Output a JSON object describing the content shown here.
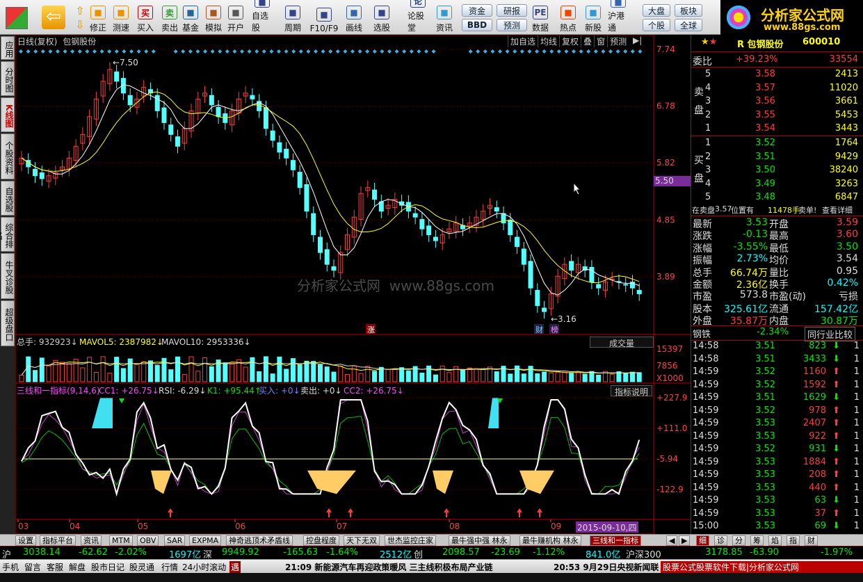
{
  "toolbar": {
    "buttons": [
      {
        "label": "修正",
        "icon": "refresh-icon"
      },
      {
        "label": "测速",
        "icon": "clock-icon"
      },
      {
        "label": "买入",
        "icon": "buy-icon",
        "glyph": "买"
      },
      {
        "label": "卖出",
        "icon": "sell-icon",
        "glyph": "卖"
      },
      {
        "label": "基金",
        "icon": "fund-icon"
      },
      {
        "label": "模拟",
        "icon": "hammer-icon"
      },
      {
        "label": "开户",
        "icon": "lock-icon"
      },
      {
        "label": "自选股",
        "icon": "star-icon"
      },
      {
        "label": "周期",
        "icon": "period-icon"
      },
      {
        "label": "F10/F9",
        "icon": "f10-icon"
      },
      {
        "label": "画线",
        "icon": "pen-icon"
      },
      {
        "label": "选股",
        "icon": "screen-icon"
      },
      {
        "label": "论股堂",
        "icon": "forum-icon",
        "glyph": "论"
      },
      {
        "label": "资讯",
        "icon": "news-icon"
      },
      {
        "label": "数据",
        "icon": "pe-icon",
        "glyph": "PE"
      },
      {
        "label": "热点",
        "icon": "hot-icon"
      },
      {
        "label": "新股",
        "icon": "ipo-icon"
      },
      {
        "label": "沪港通",
        "icon": "hk-icon"
      }
    ],
    "pills": {
      "fund": "资金",
      "research": "研报",
      "bbd": "BBD",
      "forecast": "预测",
      "dapan": "大盘",
      "bankuai": "板块",
      "gegu": "个股",
      "quanqiu": "全球"
    }
  },
  "logo": {
    "title": "分析家公式网",
    "url": "www.88gs.com"
  },
  "leftbar": [
    "应用",
    "分时图",
    "K线图",
    "个股资料",
    "自选股",
    "综合排名",
    "牛叉诊股",
    "超级盘口"
  ],
  "chart": {
    "title": "日线(复权)",
    "name": "包钢股份",
    "buttons": [
      "加自选",
      "均线",
      "复权",
      "叠",
      "窗",
      "预测"
    ],
    "price_axis": [
      "7.74",
      "6.78",
      "5.82",
      "5.50",
      "4.85",
      "3.89"
    ],
    "high_label": "7.50",
    "low_label": "3.16",
    "watermark": "分析家公式网  www.88gs.com",
    "marks": {
      "zhang": "涨",
      "cai": "财",
      "bang": "榜"
    },
    "vol_header": {
      "total": "总手: 932923",
      "mavol5": "MAVOL5: 2387982",
      "mavol10": "MAVOL10: 2953336"
    },
    "vol_button": "成交量",
    "vol_axis": [
      "15397",
      "7856",
      "X1000"
    ],
    "ind_header": {
      "name": "三线和一指标(9,14,6)",
      "cc1": "CC1: +26.75",
      "rsi": "RSI: -6.29",
      "k1": "K1: +95.44",
      "buy": "买入: +0",
      "sell": "卖出: +0",
      "cc2": "CC2: +26.75"
    },
    "ind_button": "指标说明",
    "ind_axis": [
      "+227.9",
      "+111.0",
      "-5.94",
      "-122.9"
    ],
    "months": [
      "03",
      "04",
      "05",
      "06",
      "07",
      "08",
      "09"
    ],
    "date_label": "2015-09-10,四"
  },
  "quote": {
    "title": "R 包钢股份",
    "code": "600010",
    "weibi": {
      "label": "委比",
      "pct": "+39.23%",
      "val": "33554"
    },
    "sell": [
      {
        "n": "5",
        "p": "3.58",
        "v": "2413"
      },
      {
        "n": "4",
        "p": "3.57",
        "v": "11020"
      },
      {
        "n": "3",
        "p": "3.56",
        "v": "3661"
      },
      {
        "n": "2",
        "p": "3.55",
        "v": "5453"
      },
      {
        "n": "1",
        "p": "3.54",
        "v": "3443"
      }
    ],
    "buy": [
      {
        "n": "1",
        "p": "3.52",
        "v": "1764"
      },
      {
        "n": "2",
        "p": "3.51",
        "v": "9429"
      },
      {
        "n": "3",
        "p": "3.50",
        "v": "38240"
      },
      {
        "n": "4",
        "p": "3.49",
        "v": "3263"
      },
      {
        "n": "5",
        "p": "3.48",
        "v": "6847"
      }
    ],
    "sell_label": "卖盘",
    "buy_label": "买盘",
    "info_line": {
      "a": "在卖盘",
      "b": "3.57",
      "c": "位置有",
      "d": "11478手",
      "e": "卖单!",
      "f": "查看详细"
    },
    "stats": [
      [
        "最新",
        "3.53",
        "开盘",
        "3.59"
      ],
      [
        "涨跌",
        "-0.13",
        "最高",
        "3.60"
      ],
      [
        "涨幅",
        "-3.55%",
        "最低",
        "3.50"
      ],
      [
        "振幅",
        "2.73%",
        "均价",
        "3.54"
      ],
      [
        "总手",
        "66.74万",
        "量比",
        "0.95"
      ],
      [
        "金额",
        "2.36亿",
        "换手",
        "0.42%"
      ],
      [
        "市盈",
        "573.8",
        "市盈(动)",
        "亏损"
      ],
      [
        "股本",
        "325.61亿",
        "流通",
        "157.42亿"
      ],
      [
        "外盘",
        "35.87万",
        "内盘",
        "30.87万"
      ]
    ],
    "sector": {
      "name": "钢铁",
      "pct": "-2.34%",
      "link": "同行业比较"
    },
    "ticks": [
      [
        "14:58",
        "3.51",
        "823",
        "down",
        "1"
      ],
      [
        "14:58",
        "3.51",
        "3433",
        "down",
        "1"
      ],
      [
        "14:59",
        "3.52",
        "1160",
        "up",
        "1"
      ],
      [
        "14:59",
        "3.52",
        "1592",
        "up",
        "1"
      ],
      [
        "14:59",
        "3.51",
        "1629",
        "down",
        "1"
      ],
      [
        "14:59",
        "3.52",
        "978",
        "up",
        "1"
      ],
      [
        "14:59",
        "3.53",
        "2407",
        "up",
        "1"
      ],
      [
        "14:59",
        "3.53",
        "922",
        "up",
        "1"
      ],
      [
        "14:59",
        "3.52",
        "931",
        "down",
        "1"
      ],
      [
        "14:59",
        "3.53",
        "1884",
        "up",
        "1"
      ],
      [
        "14:59",
        "3.53",
        "208",
        "up",
        "1"
      ],
      [
        "14:59",
        "3.53",
        "440",
        "up",
        "1"
      ],
      [
        "14:59",
        "3.53",
        "63",
        "down",
        "1"
      ],
      [
        "14:59",
        "3.53",
        "37",
        "up",
        "1"
      ],
      [
        "15:00",
        "3.53",
        "69",
        "down",
        "1"
      ]
    ]
  },
  "bottom_tabs": [
    "设置",
    "指标平台",
    "资讯",
    "MTM",
    "OBV",
    "SAR",
    "EXPMA",
    "神奇逃顶术矛盾线",
    "控盘程度",
    "天下无双",
    "世杰监控庄家",
    "最牛强中强 林永",
    "最牛赚机构 林永",
    "三线和一指标"
  ],
  "right_tabs": [
    "细",
    "诊",
    "分",
    "筹",
    "焰",
    "指",
    "财"
  ],
  "index_bar": {
    "sh": "沪",
    "sh_val": "3038.14",
    "sh_chg": "-62.62",
    "sh_pct": "-2.02%",
    "sh_amt": "1697亿",
    "sz": "深",
    "sz_val": "9949.92",
    "sz_chg": "-165.63",
    "sz_pct": "-1.64%",
    "sz_amt": "2512亿",
    "cy": "创",
    "cy_val": "2098.57",
    "cy_chg": "-23.69",
    "cy_pct": "-1.12%",
    "cy_amt": "841.0亿",
    "hs": "沪深300",
    "hs_val": "3178.85",
    "hs_chg": "-63.90",
    "hs_pct": "-1.97%"
  },
  "status": {
    "items": [
      "手机",
      "留言",
      "客服",
      "解盘",
      "股市日记",
      "股灵通",
      "行情",
      "24小时滚动"
    ],
    "yu": "遇",
    "news1": "21:09 新能源汽车再迎政策暖风  三主线积极布局产业链",
    "news2": "20:53 9月29日央视新闻联",
    "ad": "股票公式股票软件下载|分析家公式网"
  },
  "colors": {
    "up": "#ff3b3b",
    "down": "#54ffff",
    "ma_white": "#ffffff",
    "ma_yellow": "#ffff00",
    "axis": "#b00000"
  }
}
